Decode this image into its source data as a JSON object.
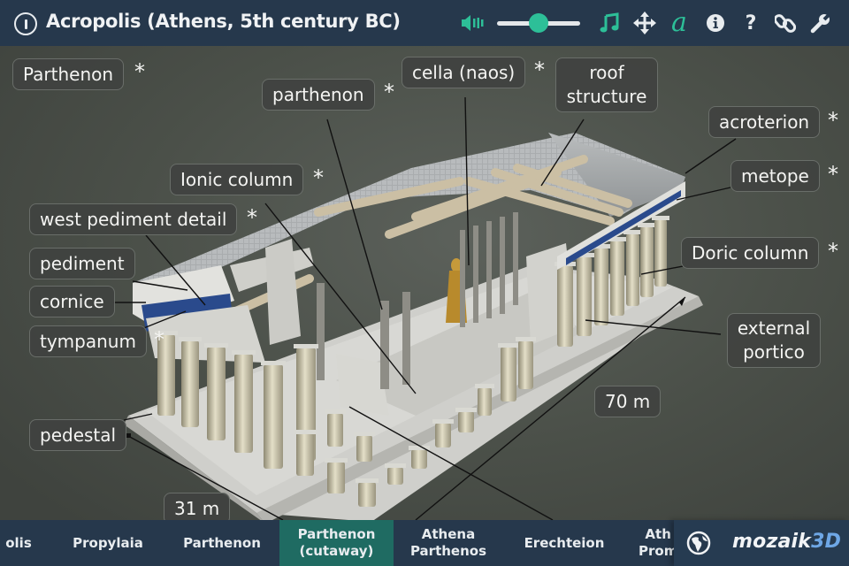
{
  "header": {
    "title": "Acropolis (Athens, 5th century BC)",
    "volume": 0.5,
    "tools": [
      {
        "name": "volume-icon",
        "label": "Volume"
      },
      {
        "name": "music-icon",
        "label": "Music"
      },
      {
        "name": "move-icon",
        "label": "Move"
      },
      {
        "name": "labels-icon",
        "label": "Labels"
      },
      {
        "name": "info-icon",
        "label": "Information"
      },
      {
        "name": "help-icon",
        "label": "Help"
      },
      {
        "name": "link-icon",
        "label": "Links"
      },
      {
        "name": "settings-icon",
        "label": "Settings"
      }
    ],
    "accent": "#2dbf98"
  },
  "labels": {
    "parthenon_title": "Parthenon",
    "parthenon": "parthenon",
    "cella": "cella (naos)",
    "roof_line1": "roof",
    "roof_line2": "structure",
    "acroterion": "acroterion",
    "metope": "metope",
    "ionic_column": "Ionic column",
    "west_pediment": "west pediment detail",
    "pediment": "pediment",
    "cornice": "cornice",
    "tympanum": "tympanum",
    "doric_column": "Doric column",
    "external_line1": "external",
    "external_line2": "portico",
    "length": "70 m",
    "width": "31 m",
    "pedestal": "pedestal",
    "star": "*"
  },
  "nav": {
    "items": [
      {
        "label": "olis"
      },
      {
        "label": "Propylaia"
      },
      {
        "label": "Parthenon"
      },
      {
        "label": "Parthenon",
        "label2": "(cutaway)",
        "active": true
      },
      {
        "label": "Athena",
        "label2": "Parthenos"
      },
      {
        "label": "Erechteion"
      },
      {
        "label": "Ath",
        "label2": "Prom"
      }
    ],
    "active_color": "#1f6b62"
  },
  "brand": {
    "name": "mozaik",
    "suffix": "3D"
  }
}
